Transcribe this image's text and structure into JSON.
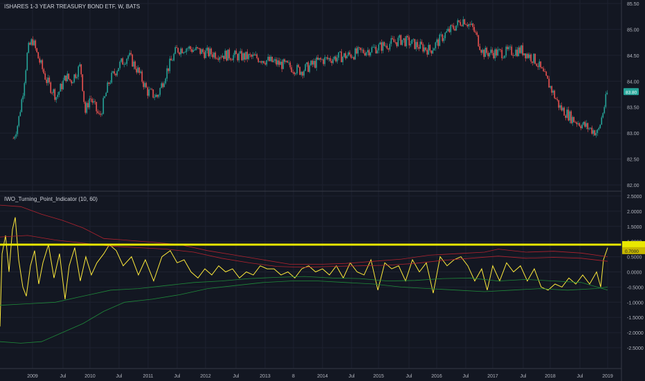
{
  "chart_data": [
    {
      "type": "candlestick",
      "title": "ISHARES 1-3 YEAR TREASURY BOND ETF, W, BATS",
      "last_price_label": "83.80",
      "ylim": [
        82.0,
        85.5
      ],
      "y_ticks": [
        "85.50",
        "85.00",
        "84.50",
        "84.00",
        "83.50",
        "83.00",
        "82.50",
        "82.00"
      ],
      "x_ticks": [
        "2009",
        "Jul",
        "2010",
        "Jul",
        "2011",
        "Jul",
        "2012",
        "Jul",
        "2013",
        "8",
        "2014",
        "Jul",
        "2015",
        "Jul",
        "2016",
        "Jul",
        "2017",
        "Jul",
        "2018",
        "Jul",
        "2019"
      ],
      "close_path": [
        [
          "2008-09",
          82.9
        ],
        [
          "2008-10",
          83.2
        ],
        [
          "2008-11",
          83.8
        ],
        [
          "2008-12",
          84.6
        ],
        [
          "2009-01",
          84.8
        ],
        [
          "2009-02",
          84.5
        ],
        [
          "2009-04",
          84.0
        ],
        [
          "2009-06",
          83.7
        ],
        [
          "2009-08",
          84.1
        ],
        [
          "2009-09",
          84.0
        ],
        [
          "2009-11",
          84.3
        ],
        [
          "2009-12",
          83.4
        ],
        [
          "2010-01",
          83.7
        ],
        [
          "2010-03",
          83.3
        ],
        [
          "2010-05",
          84.0
        ],
        [
          "2010-07",
          84.3
        ],
        [
          "2010-09",
          84.5
        ],
        [
          "2010-11",
          84.2
        ],
        [
          "2011-01",
          83.8
        ],
        [
          "2011-03",
          83.7
        ],
        [
          "2011-05",
          84.2
        ],
        [
          "2011-07",
          84.6
        ],
        [
          "2011-09",
          84.65
        ],
        [
          "2012-01",
          84.55
        ],
        [
          "2012-06",
          84.5
        ],
        [
          "2012-12",
          84.45
        ],
        [
          "2013-06",
          84.3
        ],
        [
          "2013-09",
          84.2
        ],
        [
          "2014-01",
          84.4
        ],
        [
          "2014-07",
          84.5
        ],
        [
          "2015-01",
          84.65
        ],
        [
          "2015-06",
          84.8
        ],
        [
          "2015-12",
          84.6
        ],
        [
          "2016-03",
          84.9
        ],
        [
          "2016-07",
          85.2
        ],
        [
          "2016-09",
          85.0
        ],
        [
          "2016-11",
          84.55
        ],
        [
          "2017-03",
          84.55
        ],
        [
          "2017-07",
          84.6
        ],
        [
          "2017-10",
          84.4
        ],
        [
          "2018-01",
          83.9
        ],
        [
          "2018-03",
          83.5
        ],
        [
          "2018-06",
          83.25
        ],
        [
          "2018-09",
          83.1
        ],
        [
          "2018-11",
          83.0
        ],
        [
          "2018-12",
          83.4
        ],
        [
          "2019-01",
          83.8
        ]
      ]
    },
    {
      "type": "line",
      "title": "IWO_Turning_Point_Indicator (10, 60)",
      "ylim": [
        -2.5,
        2.5
      ],
      "y_ticks": [
        "2.5000",
        "2.0000",
        "1.5000",
        "1.0000",
        "0.5000",
        "0.0000",
        "-0.5000",
        "-1.0000",
        "-1.5000",
        "-2.0000",
        "-2.5000"
      ],
      "last_value_label": "0.7000",
      "threshold": 0.9,
      "series": [
        {
          "color": "#ffeb3b",
          "values": [
            [
              0,
              -1.8
            ],
            [
              3,
              0.6
            ],
            [
              8,
              1.2
            ],
            [
              13,
              0.0
            ],
            [
              18,
              1.4
            ],
            [
              22,
              1.8
            ],
            [
              27,
              0.4
            ],
            [
              33,
              -0.5
            ],
            [
              38,
              -0.8
            ],
            [
              44,
              0.2
            ],
            [
              50,
              0.7
            ],
            [
              56,
              -0.4
            ],
            [
              62,
              0.3
            ],
            [
              70,
              0.9
            ],
            [
              78,
              -0.2
            ],
            [
              86,
              0.6
            ],
            [
              94,
              -0.9
            ],
            [
              100,
              0.2
            ],
            [
              108,
              0.8
            ],
            [
              116,
              -0.3
            ],
            [
              124,
              0.5
            ],
            [
              132,
              -0.1
            ],
            [
              140,
              0.3
            ],
            [
              150,
              0.6
            ],
            [
              158,
              0.9
            ],
            [
              168,
              0.7
            ],
            [
              178,
              0.2
            ],
            [
              190,
              0.5
            ],
            [
              200,
              -0.1
            ],
            [
              210,
              0.4
            ],
            [
              222,
              -0.3
            ],
            [
              234,
              0.5
            ],
            [
              246,
              0.7
            ],
            [
              256,
              0.3
            ],
            [
              266,
              0.4
            ],
            [
              276,
              0.0
            ],
            [
              286,
              -0.2
            ],
            [
              296,
              0.1
            ],
            [
              306,
              -0.1
            ],
            [
              316,
              0.2
            ],
            [
              326,
              0.0
            ],
            [
              336,
              0.1
            ],
            [
              346,
              -0.2
            ],
            [
              356,
              0.0
            ],
            [
              366,
              -0.1
            ],
            [
              376,
              0.2
            ],
            [
              386,
              0.1
            ],
            [
              396,
              0.1
            ],
            [
              406,
              -0.1
            ],
            [
              416,
              0.0
            ],
            [
              426,
              -0.2
            ],
            [
              436,
              0.1
            ],
            [
              446,
              0.2
            ],
            [
              456,
              0.0
            ],
            [
              466,
              0.1
            ],
            [
              476,
              -0.1
            ],
            [
              486,
              0.2
            ],
            [
              496,
              -0.2
            ],
            [
              506,
              0.3
            ],
            [
              516,
              0.0
            ],
            [
              526,
              -0.1
            ],
            [
              536,
              0.4
            ],
            [
              546,
              -0.6
            ],
            [
              556,
              0.3
            ],
            [
              566,
              0.1
            ],
            [
              576,
              0.2
            ],
            [
              586,
              -0.3
            ],
            [
              596,
              0.4
            ],
            [
              606,
              0.0
            ],
            [
              616,
              0.3
            ],
            [
              626,
              -0.7
            ],
            [
              636,
              0.5
            ],
            [
              646,
              0.2
            ],
            [
              656,
              0.4
            ],
            [
              666,
              0.5
            ],
            [
              676,
              0.2
            ],
            [
              686,
              -0.3
            ],
            [
              696,
              0.1
            ],
            [
              704,
              -0.6
            ],
            [
              712,
              0.2
            ],
            [
              722,
              -0.3
            ],
            [
              732,
              0.3
            ],
            [
              742,
              0.0
            ],
            [
              752,
              0.2
            ],
            [
              762,
              -0.3
            ],
            [
              772,
              0.1
            ],
            [
              782,
              -0.5
            ],
            [
              792,
              -0.6
            ],
            [
              802,
              -0.4
            ],
            [
              812,
              -0.5
            ],
            [
              822,
              -0.2
            ],
            [
              832,
              -0.4
            ],
            [
              842,
              -0.1
            ],
            [
              852,
              -0.4
            ],
            [
              862,
              0.0
            ],
            [
              868,
              -0.5
            ],
            [
              872,
              0.4
            ],
            [
              878,
              0.8
            ]
          ]
        },
        {
          "color": "#b2232f",
          "values": [
            [
              0,
              2.2
            ],
            [
              30,
              2.15
            ],
            [
              60,
              1.9
            ],
            [
              90,
              1.7
            ],
            [
              120,
              1.45
            ],
            [
              150,
              1.1
            ],
            [
              180,
              1.05
            ],
            [
              220,
              0.98
            ],
            [
              260,
              0.9
            ],
            [
              300,
              0.7
            ],
            [
              340,
              0.55
            ],
            [
              380,
              0.4
            ],
            [
              420,
              0.25
            ],
            [
              460,
              0.25
            ],
            [
              500,
              0.28
            ],
            [
              540,
              0.35
            ],
            [
              580,
              0.42
            ],
            [
              620,
              0.55
            ],
            [
              660,
              0.6
            ],
            [
              700,
              0.65
            ],
            [
              720,
              0.75
            ],
            [
              760,
              0.65
            ],
            [
              800,
              0.68
            ],
            [
              840,
              0.62
            ],
            [
              878,
              0.5
            ]
          ]
        },
        {
          "color": "#b2232f",
          "values": [
            [
              0,
              1.15
            ],
            [
              40,
              1.2
            ],
            [
              80,
              1.05
            ],
            [
              120,
              0.95
            ],
            [
              160,
              0.85
            ],
            [
              200,
              0.8
            ],
            [
              240,
              0.75
            ],
            [
              280,
              0.65
            ],
            [
              320,
              0.45
            ],
            [
              360,
              0.3
            ],
            [
              400,
              0.18
            ],
            [
              440,
              0.15
            ],
            [
              480,
              0.18
            ],
            [
              520,
              0.2
            ],
            [
              560,
              0.22
            ],
            [
              600,
              0.28
            ],
            [
              640,
              0.38
            ],
            [
              680,
              0.45
            ],
            [
              720,
              0.52
            ],
            [
              760,
              0.45
            ],
            [
              800,
              0.48
            ],
            [
              840,
              0.45
            ],
            [
              878,
              0.35
            ]
          ]
        },
        {
          "color": "#1f8a3a",
          "values": [
            [
              0,
              -1.1
            ],
            [
              40,
              -1.05
            ],
            [
              80,
              -1.0
            ],
            [
              120,
              -0.8
            ],
            [
              160,
              -0.6
            ],
            [
              200,
              -0.55
            ],
            [
              240,
              -0.45
            ],
            [
              280,
              -0.35
            ],
            [
              320,
              -0.3
            ],
            [
              360,
              -0.22
            ],
            [
              400,
              -0.18
            ],
            [
              440,
              -0.15
            ],
            [
              480,
              -0.2
            ],
            [
              520,
              -0.22
            ],
            [
              560,
              -0.3
            ],
            [
              600,
              -0.28
            ],
            [
              640,
              -0.22
            ],
            [
              680,
              -0.2
            ],
            [
              720,
              -0.3
            ],
            [
              760,
              -0.25
            ],
            [
              800,
              -0.3
            ],
            [
              840,
              -0.35
            ],
            [
              878,
              -0.6
            ]
          ]
        },
        {
          "color": "#1f8a3a",
          "values": [
            [
              0,
              -2.3
            ],
            [
              30,
              -2.35
            ],
            [
              60,
              -2.3
            ],
            [
              90,
              -2.0
            ],
            [
              120,
              -1.7
            ],
            [
              150,
              -1.3
            ],
            [
              180,
              -1.0
            ],
            [
              220,
              -0.9
            ],
            [
              260,
              -0.75
            ],
            [
              300,
              -0.55
            ],
            [
              340,
              -0.45
            ],
            [
              380,
              -0.35
            ],
            [
              420,
              -0.3
            ],
            [
              460,
              -0.3
            ],
            [
              500,
              -0.35
            ],
            [
              540,
              -0.4
            ],
            [
              580,
              -0.5
            ],
            [
              620,
              -0.55
            ],
            [
              660,
              -0.6
            ],
            [
              700,
              -0.65
            ],
            [
              740,
              -0.6
            ],
            [
              780,
              -0.55
            ],
            [
              820,
              -0.6
            ],
            [
              860,
              -0.55
            ],
            [
              878,
              -0.5
            ]
          ]
        }
      ]
    }
  ],
  "colors": {
    "background": "#131722",
    "grid": "#1e2230",
    "up": "#26a69a",
    "down": "#ef5350",
    "price_tag": "#26a69a",
    "threshold": "#e8e800",
    "axis_text": "#b2b5be"
  }
}
